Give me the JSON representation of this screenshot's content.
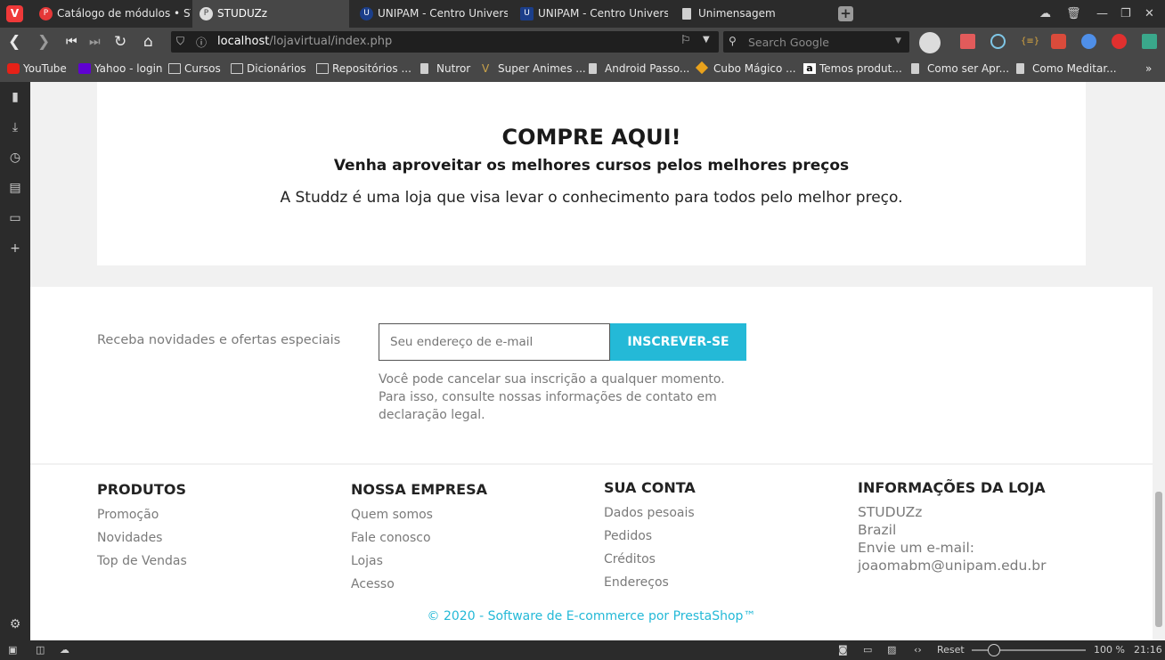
{
  "browser": {
    "tabs": [
      {
        "label": "Catálogo de módulos • STUDUZz",
        "active": false
      },
      {
        "label": "STUDUZz",
        "active": true
      },
      {
        "label": "UNIPAM - Centro Universitário",
        "active": false
      },
      {
        "label": "UNIPAM - Centro Universitário",
        "active": false
      },
      {
        "label": "Unimensagem",
        "active": false
      }
    ],
    "url_host": "localhost",
    "url_path": "/lojavirtual/index.php",
    "search_placeholder": "Search Google",
    "bookmarks": [
      "YouTube",
      "Yahoo - login",
      "Cursos",
      "Dicionários",
      "Repositórios ...",
      "Nutror",
      "Super Animes ...",
      "Android Passo...",
      "Cubo Mágico ...",
      "Temos produt...",
      "Como ser Apr...",
      "Como Meditar..."
    ],
    "status": {
      "reset": "Reset",
      "zoom": "100 %",
      "time": "21:16"
    }
  },
  "promo": {
    "title": "COMPRE AQUI!",
    "subtitle": "Venha aproveitar os melhores cursos pelos melhores preços",
    "text": "A Studdz é uma loja que visa levar o conhecimento para todos pelo melhor preço."
  },
  "newsletter": {
    "label": "Receba novidades e ofertas especiais",
    "placeholder": "Seu endereço de e-mail",
    "button": "INSCREVER-SE",
    "note_lines": [
      "Você pode cancelar sua inscrição a qualquer momento.",
      "Para isso, consulte nossas informações de contato em",
      "declaração legal."
    ]
  },
  "footer": {
    "produtos": {
      "title": "PRODUTOS",
      "links": [
        "Promoção",
        "Novidades",
        "Top de Vendas"
      ]
    },
    "empresa": {
      "title": "NOSSA EMPRESA",
      "links": [
        "Quem somos",
        "Fale conosco",
        "Lojas",
        "Acesso"
      ]
    },
    "conta": {
      "title": "SUA CONTA",
      "links": [
        "Dados pesoais",
        "Pedidos",
        "Créditos",
        "Endereços"
      ]
    },
    "info": {
      "title": "INFORMAÇÕES DA LOJA",
      "lines": [
        "STUDUZz",
        "Brazil",
        "Envie um e-mail:",
        "joaomabm@unipam.edu.br"
      ]
    },
    "copyright": "© 2020 - Software de E-commerce por PrestaShop™"
  },
  "colors": {
    "accent": "#24b9d7",
    "browser_dark": "#2b2b2b",
    "browser_mid": "#474747"
  }
}
